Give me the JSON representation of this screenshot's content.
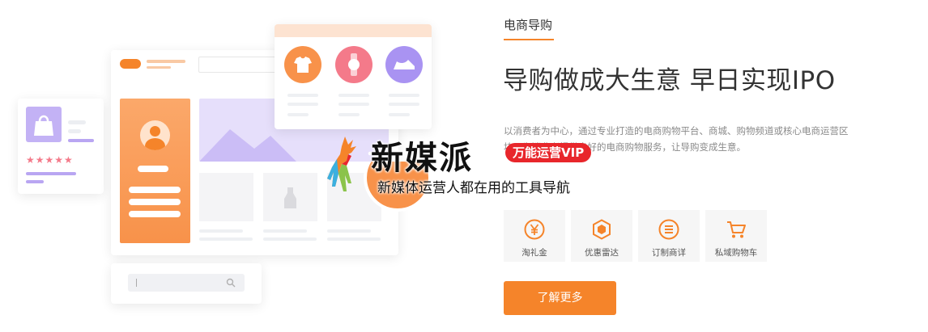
{
  "section": {
    "kicker": "电商导购",
    "headline": "导购做成大生意 早日实现IPO",
    "description_line1": "以消费者为中心，通过专业打造的电商购物平台、商城、购物频道或核心电商运营区",
    "description_line2": "块，为消费者提供良好的电商购物服务，让导购变成生意。",
    "features": [
      {
        "label": "淘礼金",
        "icon": "yen-coin-icon"
      },
      {
        "label": "优惠雷达",
        "icon": "discount-radar-icon"
      },
      {
        "label": "订制商详",
        "icon": "list-detail-icon"
      },
      {
        "label": "私域购物车",
        "icon": "shopping-cart-icon"
      }
    ],
    "cta_label": "了解更多"
  },
  "illustration": {
    "rating_stars": "★★★★★",
    "rating_value": 5
  },
  "watermark": {
    "title": "新媒派",
    "badge": "万能运营VIP",
    "subtitle": "新媒体运营人都在用的工具导航"
  },
  "colors": {
    "accent": "#f5842a",
    "badge_red": "#e8262b",
    "lavender": "#b9a6f2",
    "pink": "#f47a8a"
  }
}
